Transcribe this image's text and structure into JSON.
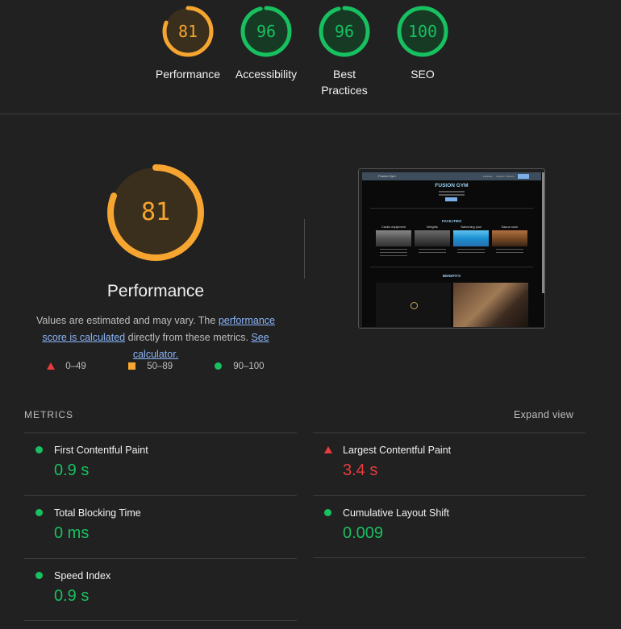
{
  "summary_gauges": [
    {
      "score": "81",
      "label": "Performance",
      "color": "#f6a630",
      "fraction": 0.81
    },
    {
      "score": "96",
      "label": "Accessibility",
      "color": "#18c060",
      "fraction": 0.96
    },
    {
      "score": "96",
      "label": "Best Practices",
      "color": "#18c060",
      "fraction": 0.96
    },
    {
      "score": "100",
      "label": "SEO",
      "color": "#18c060",
      "fraction": 1.0
    }
  ],
  "performance": {
    "score": "81",
    "fraction": 0.81,
    "title": "Performance",
    "desc_pre": "Values are estimated and may vary. The ",
    "desc_link1": "performance score is calculated",
    "desc_mid": " directly from these metrics. ",
    "desc_link2": "See calculator."
  },
  "legend": [
    {
      "icon": "triangle-red",
      "range": "0–49"
    },
    {
      "icon": "square-orange",
      "range": "50–89"
    },
    {
      "icon": "circle-green",
      "range": "90–100"
    }
  ],
  "screenshot": {
    "brand": "Fusion Gym",
    "nav_links": [
      "Facilities",
      "Classes",
      "Trainers"
    ],
    "title": "FUSION GYM",
    "facilities_heading": "FACILITIES",
    "facilities": [
      "Cardio equipment",
      "Weights",
      "Swimming pool",
      "Sauna room"
    ],
    "benefits_heading": "BENEFITS"
  },
  "metrics": {
    "heading": "METRICS",
    "expand_label": "Expand view",
    "items": [
      {
        "name": "First Contentful Paint",
        "value": "0.9 s",
        "status": "good"
      },
      {
        "name": "Largest Contentful Paint",
        "value": "3.4 s",
        "status": "poor"
      },
      {
        "name": "Total Blocking Time",
        "value": "0 ms",
        "status": "good"
      },
      {
        "name": "Cumulative Layout Shift",
        "value": "0.009",
        "status": "good"
      },
      {
        "name": "Speed Index",
        "value": "0.9 s",
        "status": "good"
      }
    ]
  },
  "colors": {
    "good": "#18c060",
    "average": "#f6a630",
    "poor": "#ea3b3b"
  }
}
